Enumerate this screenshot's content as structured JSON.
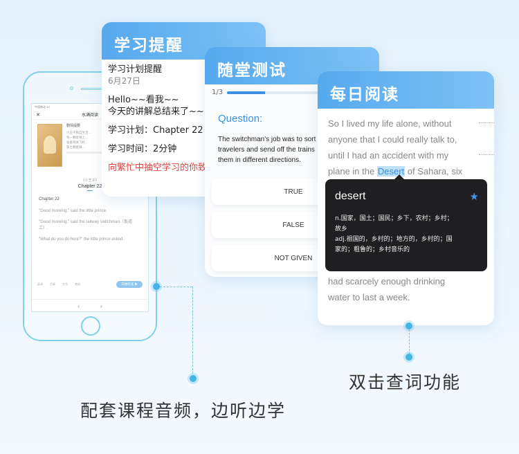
{
  "phone": {
    "status_left": "中国移动 4G",
    "status_right": "下午6:05",
    "nav_title": "水满阅读",
    "close_glyph": "✕",
    "nav_action": "...",
    "book_title": "剧情提要",
    "book_desc": [
      "小王子独自生活…",
      "有一颗星球上…",
      "准备驾驶飞机…",
      "第七颗星球…"
    ],
    "toc_label": "《小王子》",
    "chapter_title": "Chapter 22",
    "chapter_heading": "Chapter 22",
    "lines": [
      "\"Good morning,\" said the little prince.",
      "\"Good morning,\" said the railway switchman（扳道工）.",
      "\"What do you do here?\" the little prince asked."
    ],
    "tools": [
      "英译",
      "目录",
      "字号",
      "夜间"
    ],
    "play_label": "开始听读 ▶",
    "back_glyph": "‹",
    "forward_glyph": "›"
  },
  "reminder": {
    "title": "学习提醒",
    "plan_title": "学习计划提醒",
    "date": "6月27日",
    "greeting": "Hello~~看我~~",
    "summary": "今天的讲解总结来了~~~",
    "plan_label": "学习计划：Chapter 22",
    "time_label": "学习时间：2分钟",
    "red_text": "向繁忙中抽空学习的你致敬"
  },
  "quiz": {
    "title": "随堂测试",
    "progress_text": "1/3",
    "progress_fraction": 0.33,
    "question_label": "Question:",
    "question_lines": [
      "The switchman's job was to sort",
      "travelers and send off the trains",
      "them in different directions."
    ],
    "options": [
      "TRUE",
      "FALSE",
      "NOT GIVEN"
    ]
  },
  "reading": {
    "title": "每日阅读",
    "line1": "So I lived my life alone, without",
    "line2": "anyone that I could really talk to,",
    "line3": "until I had an accident with my",
    "line4_pre": "plane in the ",
    "line4_word": "Desert",
    "line4_post": " of Sahara, six",
    "after1": "had scarcely enough drinking",
    "after2": "water to last a week.",
    "play_glyph": "▶"
  },
  "dictionary": {
    "word": "desert",
    "star_glyph": "★",
    "definitions": [
      "n.国家，国土；国民；乡下，农村；乡村；",
      "故乡",
      "adj.祖国的，乡村的；地方的，乡村的；国",
      "家的；粗鲁的；乡村音乐的"
    ]
  },
  "captions": {
    "left": "配套课程音频，边听边学",
    "right": "双击查词功能"
  },
  "colors": {
    "header_gradient_start": "#56a9ee",
    "header_gradient_end": "#7dc2f5",
    "accent_blue": "#3d8fe2",
    "connector": "#73c6e6",
    "red_text": "#e0413b",
    "popup_bg": "#1f1f22"
  }
}
